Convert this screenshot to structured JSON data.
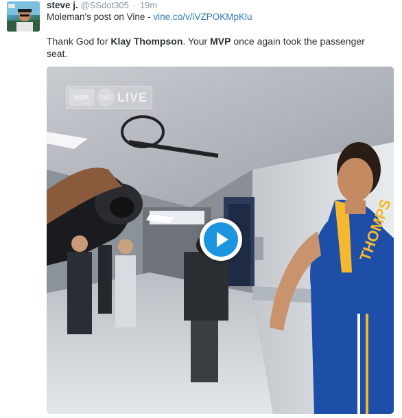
{
  "tweet": {
    "display_name": "steve j.",
    "handle": "@SSdot305",
    "separator": "·",
    "time": "19m",
    "subline_prefix": "Moleman's post on Vine - ",
    "subline_link": "vine.co/v/iVZPOKMpKlu",
    "text_part1": "Thank God for ",
    "text_bold1": "Klay Thompson",
    "text_part2": ".  Your ",
    "text_bold2": "MVP",
    "text_part3": " once again took the passenger seat."
  },
  "media": {
    "bug_league": "NBA",
    "bug_network": "TNT",
    "bug_live": "LIVE",
    "jersey_text": "THOMPS"
  },
  "colors": {
    "link": "#2b7bb9",
    "muted": "#8899a6",
    "play_button": "#1b95e0",
    "jersey_blue": "#1d4fa8",
    "jersey_gold": "#f5b82e"
  }
}
